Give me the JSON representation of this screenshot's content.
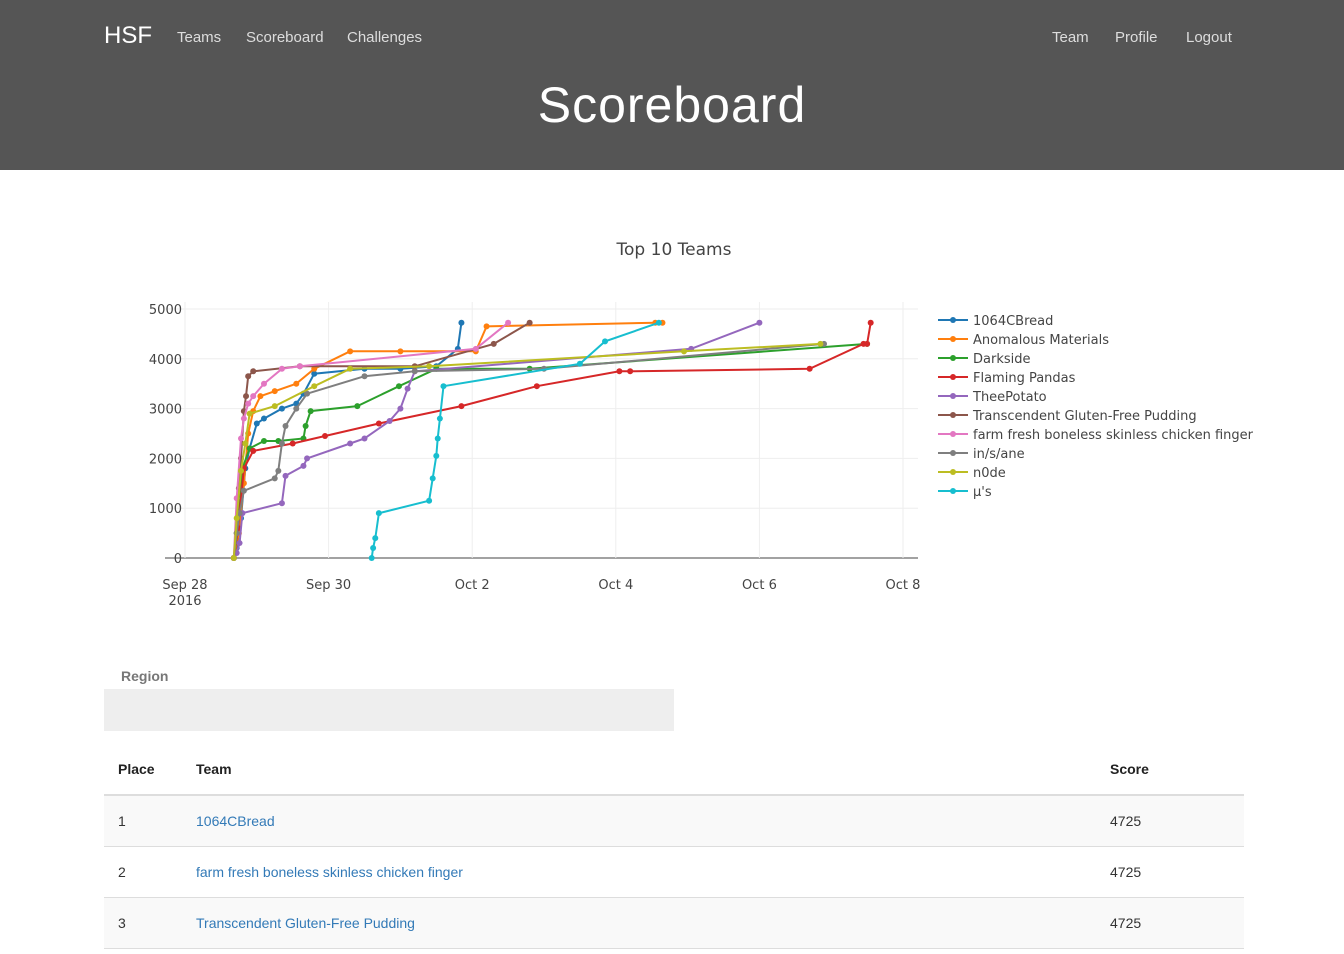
{
  "nav": {
    "brand": "HSF",
    "left_links": [
      "Teams",
      "Scoreboard",
      "Challenges"
    ],
    "right_links": [
      "Team",
      "Profile",
      "Logout"
    ]
  },
  "page_title": "Scoreboard",
  "colors": {
    "navbar_bg": "#555555",
    "link": "#337ab7",
    "series": [
      "#1f77b4",
      "#ff7f0e",
      "#2ca02c",
      "#d62728",
      "#9467bd",
      "#8c564b",
      "#e377c2",
      "#7f7f7f",
      "#bcbd22",
      "#17becf"
    ]
  },
  "chart_data": {
    "type": "line",
    "title": "Top 10 Teams",
    "xlabel": "",
    "ylabel": "",
    "ylim": [
      0,
      5000
    ],
    "xlim": [
      "Sep 28 2016",
      "Oct 8 2016"
    ],
    "y_ticks": [
      "0",
      "1000",
      "2000",
      "3000",
      "4000",
      "5000"
    ],
    "x_ticks": [
      {
        "label": "Sep 28",
        "sub": "2016"
      },
      {
        "label": "Sep 30",
        "sub": ""
      },
      {
        "label": "Oct 2",
        "sub": ""
      },
      {
        "label": "Oct 4",
        "sub": ""
      },
      {
        "label": "Oct 6",
        "sub": ""
      },
      {
        "label": "Oct 8",
        "sub": ""
      }
    ],
    "grid": true,
    "legend": "right",
    "series": [
      {
        "name": "1064CBread",
        "color": "#1f77b4",
        "points": [
          [
            0.68,
            0
          ],
          [
            0.72,
            200
          ],
          [
            0.78,
            800
          ],
          [
            0.84,
            1800
          ],
          [
            0.9,
            2200
          ],
          [
            1.0,
            2700
          ],
          [
            1.1,
            2800
          ],
          [
            1.35,
            3000
          ],
          [
            1.55,
            3100
          ],
          [
            1.65,
            3300
          ],
          [
            1.8,
            3700
          ],
          [
            2.5,
            3800
          ],
          [
            3.0,
            3800
          ],
          [
            3.5,
            3850
          ],
          [
            3.8,
            4200
          ],
          [
            3.85,
            4725
          ]
        ]
      },
      {
        "name": "Anomalous Materials",
        "color": "#ff7f0e",
        "points": [
          [
            0.68,
            0
          ],
          [
            0.75,
            500
          ],
          [
            0.82,
            1500
          ],
          [
            0.88,
            2500
          ],
          [
            0.95,
            2950
          ],
          [
            1.05,
            3250
          ],
          [
            1.25,
            3350
          ],
          [
            1.55,
            3500
          ],
          [
            1.8,
            3800
          ],
          [
            2.3,
            4150
          ],
          [
            3.0,
            4150
          ],
          [
            4.05,
            4150
          ],
          [
            4.2,
            4650
          ],
          [
            6.55,
            4725
          ],
          [
            6.65,
            4725
          ]
        ]
      },
      {
        "name": "Darkside",
        "color": "#2ca02c",
        "points": [
          [
            0.68,
            0
          ],
          [
            0.74,
            600
          ],
          [
            0.8,
            1800
          ],
          [
            0.9,
            2200
          ],
          [
            1.1,
            2350
          ],
          [
            1.3,
            2350
          ],
          [
            1.65,
            2400
          ],
          [
            1.68,
            2650
          ],
          [
            1.75,
            2950
          ],
          [
            2.4,
            3050
          ],
          [
            2.98,
            3450
          ],
          [
            3.5,
            3800
          ],
          [
            4.8,
            3800
          ],
          [
            9.5,
            4300
          ]
        ]
      },
      {
        "name": "Flaming Pandas",
        "color": "#d62728",
        "points": [
          [
            0.68,
            0
          ],
          [
            0.74,
            600
          ],
          [
            0.82,
            1800
          ],
          [
            0.95,
            2150
          ],
          [
            1.5,
            2300
          ],
          [
            1.95,
            2450
          ],
          [
            2.7,
            2700
          ],
          [
            3.85,
            3050
          ],
          [
            4.9,
            3450
          ],
          [
            6.05,
            3750
          ],
          [
            6.2,
            3750
          ],
          [
            8.7,
            3800
          ],
          [
            9.45,
            4300
          ],
          [
            9.5,
            4300
          ],
          [
            9.55,
            4725
          ]
        ]
      },
      {
        "name": "TheePotato",
        "color": "#9467bd",
        "points": [
          [
            0.68,
            0
          ],
          [
            0.72,
            100
          ],
          [
            0.76,
            300
          ],
          [
            0.8,
            900
          ],
          [
            1.35,
            1100
          ],
          [
            1.4,
            1650
          ],
          [
            1.65,
            1850
          ],
          [
            1.7,
            2000
          ],
          [
            2.3,
            2300
          ],
          [
            2.5,
            2400
          ],
          [
            2.85,
            2750
          ],
          [
            3.0,
            3000
          ],
          [
            3.1,
            3400
          ],
          [
            3.2,
            3750
          ],
          [
            7.05,
            4200
          ],
          [
            8.0,
            4725
          ]
        ]
      },
      {
        "name": "Transcendent Gluten-Free Pudding",
        "color": "#8c564b",
        "points": [
          [
            0.68,
            0
          ],
          [
            0.72,
            500
          ],
          [
            0.75,
            1400
          ],
          [
            0.78,
            2000
          ],
          [
            0.82,
            2950
          ],
          [
            0.85,
            3250
          ],
          [
            0.88,
            3650
          ],
          [
            0.95,
            3750
          ],
          [
            1.6,
            3850
          ],
          [
            3.2,
            3850
          ],
          [
            4.3,
            4300
          ],
          [
            4.8,
            4725
          ]
        ]
      },
      {
        "name": "farm fresh boneless skinless chicken finger",
        "color": "#e377c2",
        "points": [
          [
            0.68,
            0
          ],
          [
            0.72,
            1200
          ],
          [
            0.78,
            2400
          ],
          [
            0.82,
            2800
          ],
          [
            0.88,
            3100
          ],
          [
            0.95,
            3250
          ],
          [
            1.1,
            3500
          ],
          [
            1.35,
            3800
          ],
          [
            1.6,
            3850
          ],
          [
            4.05,
            4200
          ],
          [
            4.5,
            4725
          ]
        ]
      },
      {
        "name": "in/s/ane",
        "color": "#7f7f7f",
        "points": [
          [
            0.68,
            0
          ],
          [
            0.72,
            500
          ],
          [
            0.76,
            900
          ],
          [
            0.82,
            1350
          ],
          [
            1.25,
            1600
          ],
          [
            1.3,
            1750
          ],
          [
            1.35,
            2300
          ],
          [
            1.4,
            2650
          ],
          [
            1.55,
            3000
          ],
          [
            1.7,
            3300
          ],
          [
            2.5,
            3650
          ],
          [
            3.2,
            3750
          ],
          [
            5.0,
            3800
          ],
          [
            8.9,
            4300
          ]
        ]
      },
      {
        "name": "n0de",
        "color": "#bcbd22",
        "points": [
          [
            0.68,
            0
          ],
          [
            0.72,
            800
          ],
          [
            0.78,
            1750
          ],
          [
            0.84,
            2300
          ],
          [
            0.9,
            2900
          ],
          [
            1.25,
            3050
          ],
          [
            1.8,
            3450
          ],
          [
            2.3,
            3800
          ],
          [
            3.4,
            3850
          ],
          [
            6.95,
            4150
          ],
          [
            8.85,
            4300
          ]
        ]
      },
      {
        "name": "μ's",
        "color": "#17becf",
        "points": [
          [
            2.6,
            0
          ],
          [
            2.62,
            200
          ],
          [
            2.65,
            400
          ],
          [
            2.7,
            900
          ],
          [
            3.4,
            1150
          ],
          [
            3.45,
            1600
          ],
          [
            3.5,
            2050
          ],
          [
            3.52,
            2400
          ],
          [
            3.55,
            2800
          ],
          [
            3.6,
            3450
          ],
          [
            5.5,
            3900
          ],
          [
            5.85,
            4350
          ],
          [
            6.6,
            4725
          ]
        ]
      }
    ]
  },
  "region": {
    "label": "Region"
  },
  "table": {
    "headers": [
      "Place",
      "Team",
      "Score"
    ],
    "rows": [
      {
        "place": "1",
        "team": "1064CBread",
        "score": "4725"
      },
      {
        "place": "2",
        "team": "farm fresh boneless skinless chicken finger",
        "score": "4725"
      },
      {
        "place": "3",
        "team": "Transcendent Gluten-Free Pudding",
        "score": "4725"
      }
    ]
  }
}
